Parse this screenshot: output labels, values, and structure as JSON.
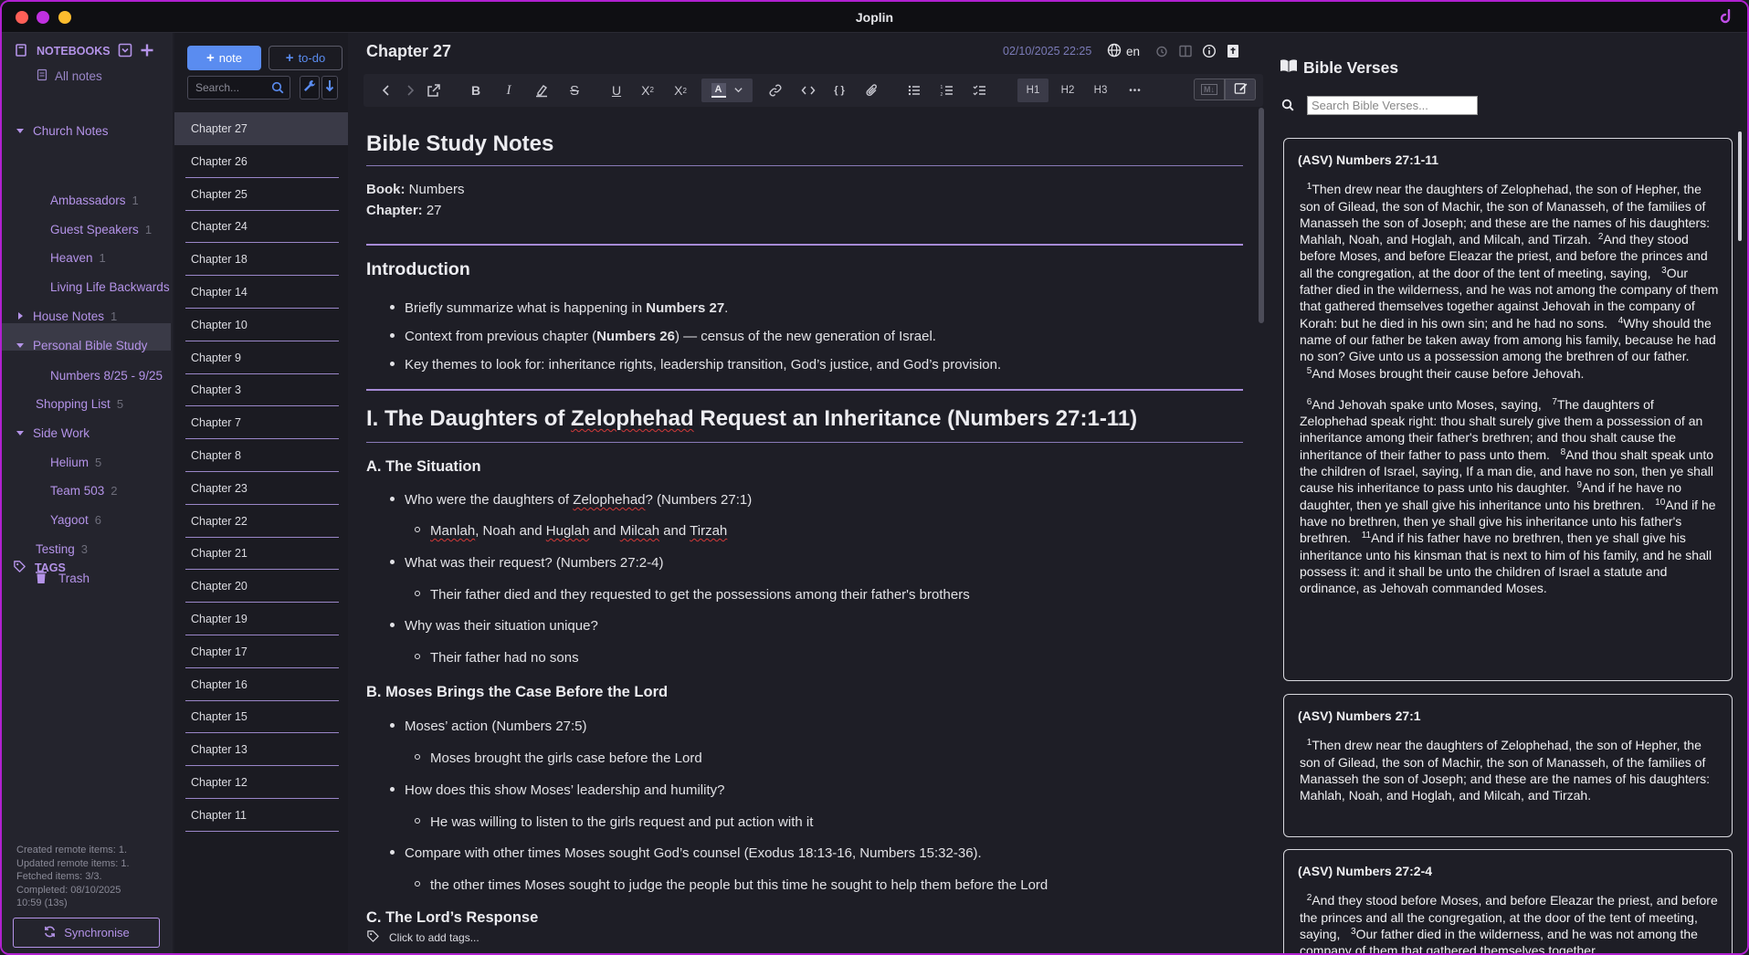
{
  "window": {
    "title": "Joplin"
  },
  "sidebar": {
    "notebooks_label": "NOTEBOOKS",
    "all_notes": "All notes",
    "items": [
      {
        "label": "Church Notes",
        "count": "",
        "level": 0,
        "caret": "down"
      },
      {
        "label": "Ambassadors",
        "count": "1",
        "level": 1
      },
      {
        "label": "Guest Speakers",
        "count": "1",
        "level": 1
      },
      {
        "label": "Heaven",
        "count": "1",
        "level": 1
      },
      {
        "label": "Living Life Backwards",
        "count": "",
        "level": 1
      },
      {
        "label": "House Notes",
        "count": "1",
        "level": 0,
        "caret": "right"
      },
      {
        "label": "Personal Bible Study",
        "count": "",
        "level": 0,
        "caret": "down"
      },
      {
        "label": "Numbers 8/25 - 9/25",
        "count": "",
        "level": 1,
        "selected": true
      },
      {
        "label": "Shopping List",
        "count": "5",
        "level": 0
      },
      {
        "label": "Side Work",
        "count": "",
        "level": 0,
        "caret": "down"
      },
      {
        "label": "Helium",
        "count": "5",
        "level": 1
      },
      {
        "label": "Team 503",
        "count": "2",
        "level": 1
      },
      {
        "label": "Yagoot",
        "count": "6",
        "level": 1
      },
      {
        "label": "Testing",
        "count": "3",
        "level": 0
      },
      {
        "label": "Trash",
        "count": "",
        "level": 0
      }
    ],
    "tags_label": "TAGS",
    "sync_status": [
      "Created remote items: 1.",
      "Updated remote items: 1.",
      "Fetched items: 3/3.",
      "Completed: 08/10/2025",
      "10:59 (13s)"
    ],
    "sync_button": "Synchronise"
  },
  "notelist": {
    "new_note": "note",
    "new_todo": "to-do",
    "search_placeholder": "Search...",
    "notes": [
      "Chapter 27",
      "Chapter 26",
      "Chapter 25",
      "Chapter 24",
      "Chapter 18",
      "Chapter 14",
      "Chapter 10",
      "Chapter 9",
      "Chapter 3",
      "Chapter 7",
      "Chapter 8",
      "Chapter 23",
      "Chapter 22",
      "Chapter 21",
      "Chapter 20",
      "Chapter 19",
      "Chapter 17",
      "Chapter 16",
      "Chapter 15",
      "Chapter 13",
      "Chapter 12",
      "Chapter 11"
    ]
  },
  "editor": {
    "title": "Chapter 27",
    "date": "02/10/2025 22:25",
    "language": "en",
    "toolbar": {
      "h1": "H1",
      "h2": "H2",
      "h3": "H3",
      "more": "•••"
    },
    "content": {
      "h1": "Bible Study Notes",
      "book_label": "Book:",
      "book_value": "Numbers",
      "chapter_label": "Chapter:",
      "chapter_value": "27",
      "intro_heading": "Introduction",
      "intro_1a": "Briefly summarize what is happening in ",
      "intro_1b": "Numbers 27",
      "intro_1c": ".",
      "intro_2a": "Context from previous chapter (",
      "intro_2b": "Numbers 26",
      "intro_2c": ") — census of the new generation of Israel.",
      "intro_3": "Key themes to look for: inheritance rights, leadership transition, God’s justice, and God’s provision.",
      "section1_a": "I. The Daughters of ",
      "section1_b": "Zelophehad",
      "section1_c": " Request an Inheritance (Numbers 27:1-11)",
      "subA": "A. The Situation",
      "a1_a": "Who were the daughters of ",
      "a1_b": "Zelophehad",
      "a1_c": "? (Numbers 27:1)",
      "a1_sub": [
        "Manlah",
        ", Noah and ",
        "Huglah",
        " and ",
        "Milcah",
        " and ",
        "Tirzah"
      ],
      "a2": "What was their request? (Numbers 27:2-4)",
      "a2_sub": "Their father died and they requested to get the possessions among their father's brothers",
      "a3": "Why was their situation unique?",
      "a3_sub": "Their father had no sons",
      "subB": "B. Moses Brings the Case Before the Lord",
      "b1": "Moses’ action (Numbers 27:5)",
      "b1_sub": "Moses brought the girls case before the Lord",
      "b2": "How does this show Moses’ leadership and humility?",
      "b2_sub": "He was willing to listen to the girls request and put action with it",
      "b3": "Compare with other times Moses sought God’s counsel (Exodus 18:13-16, Numbers 15:32-36).",
      "b3_sub": "the other times Moses sought to judge the people but this time he sought to help them before the Lord",
      "subC": "C. The Lord’s Response"
    },
    "add_tags": "Click to add tags..."
  },
  "bible_panel": {
    "title": "Bible Verses",
    "search_placeholder": "Search Bible Verses...",
    "cards": [
      {
        "ref": "(ASV) Numbers 27:1-11",
        "p1": [
          {
            "n": "1",
            "t": "Then drew near the daughters of Zelophehad, the son of Hepher, the son of Gilead, the son of Machir, the son of Manasseh, of the families of Manasseh the son of Joseph; and these are the names of his daughters: Mahlah, Noah, and Hoglah, and Milcah, and Tirzah."
          },
          {
            "n": "2",
            "t": "And they stood before Moses, and before Eleazar the priest, and before the princes and all the congregation, at the door of the tent of meeting, saying, "
          },
          {
            "n": "3",
            "t": "Our father died in the wilderness, and he was not among the company of them that gathered themselves together against Jehovah in the company of Korah: but he died in his own sin; and he had no sons. "
          },
          {
            "n": "4",
            "t": "Why should the name of our father be taken away from among his family, because he had no son? Give unto us a possession among the brethren of our father. "
          },
          {
            "n": "5",
            "t": "And Moses brought their cause before Jehovah."
          }
        ],
        "p2": [
          {
            "n": "6",
            "t": "And Jehovah spake unto Moses, saying, "
          },
          {
            "n": "7",
            "t": "The daughters of Zelophehad speak right: thou shalt surely give them a possession of an inheritance among their father's brethren; and thou shalt cause the inheritance of their father to pass unto them. "
          },
          {
            "n": "8",
            "t": "And thou shalt speak unto the children of Israel, saying, If a man die, and have no son, then ye shall cause his inheritance to pass unto his daughter."
          },
          {
            "n": "9",
            "t": "And if he have no daughter, then ye shall give his inheritance unto his brethren. "
          },
          {
            "n": "10",
            "t": "And if he have no brethren, then ye shall give his inheritance unto his father's brethren. "
          },
          {
            "n": "11",
            "t": "And if his father have no brethren, then ye shall give his inheritance unto his kinsman that is next to him of his family, and he shall possess it: and it shall be unto the children of Israel a statute and ordinance, as Jehovah commanded Moses."
          }
        ]
      },
      {
        "ref": "(ASV) Numbers 27:1",
        "p1": [
          {
            "n": "1",
            "t": "Then drew near the daughters of Zelophehad, the son of Hepher, the son of Gilead, the son of Machir, the son of Manasseh, of the families of Manasseh the son of Joseph; and these are the names of his daughters: Mahlah, Noah, and Hoglah, and Milcah, and Tirzah."
          }
        ]
      },
      {
        "ref": "(ASV) Numbers 27:2-4",
        "p1": [
          {
            "n": "2",
            "t": "And they stood before Moses, and before Eleazar the priest, and before the princes and all the congregation, at the door of the tent of meeting, saying, "
          },
          {
            "n": "3",
            "t": "Our father died in the wilderness, and he was not among the company of them that gathered themselves together"
          }
        ]
      }
    ]
  },
  "colors": {
    "accent": "#b493e8",
    "window_border": "#b020d0",
    "button_blue": "#5a8cf0"
  }
}
